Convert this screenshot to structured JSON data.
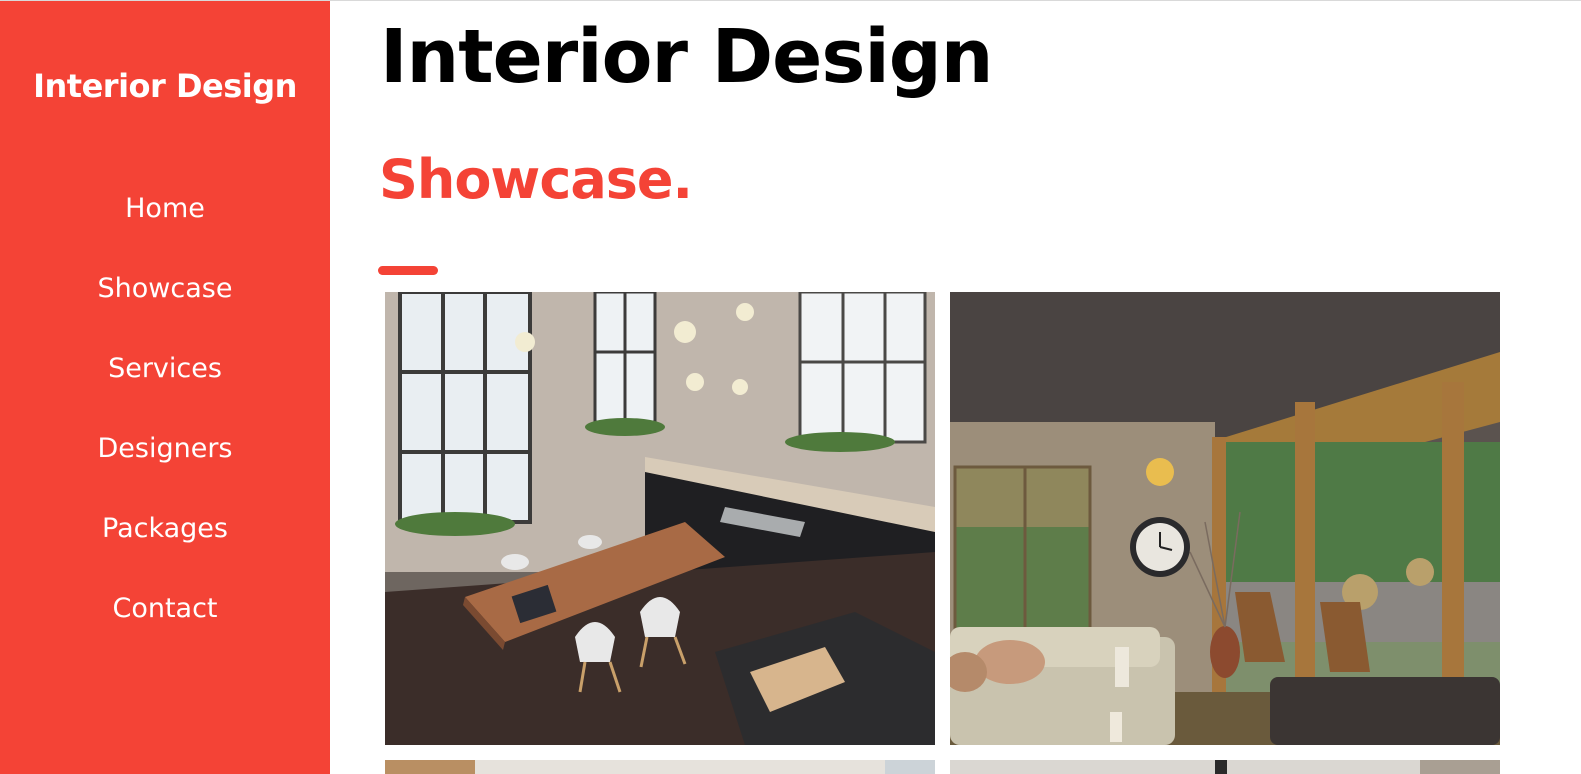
{
  "sidebar": {
    "brand": "Interior Design",
    "nav": [
      {
        "label": "Home"
      },
      {
        "label": "Showcase"
      },
      {
        "label": "Services"
      },
      {
        "label": "Designers"
      },
      {
        "label": "Packages"
      },
      {
        "label": "Contact"
      }
    ]
  },
  "main": {
    "page_title": "Interior Design",
    "section_title": "Showcase."
  },
  "colors": {
    "accent": "#f44336",
    "text": "#000000",
    "background": "#ffffff"
  },
  "images": [
    {
      "name": "showcase-photo-loft-kitchen"
    },
    {
      "name": "showcase-photo-sunroom-living"
    },
    {
      "name": "showcase-photo-3"
    },
    {
      "name": "showcase-photo-4"
    }
  ]
}
